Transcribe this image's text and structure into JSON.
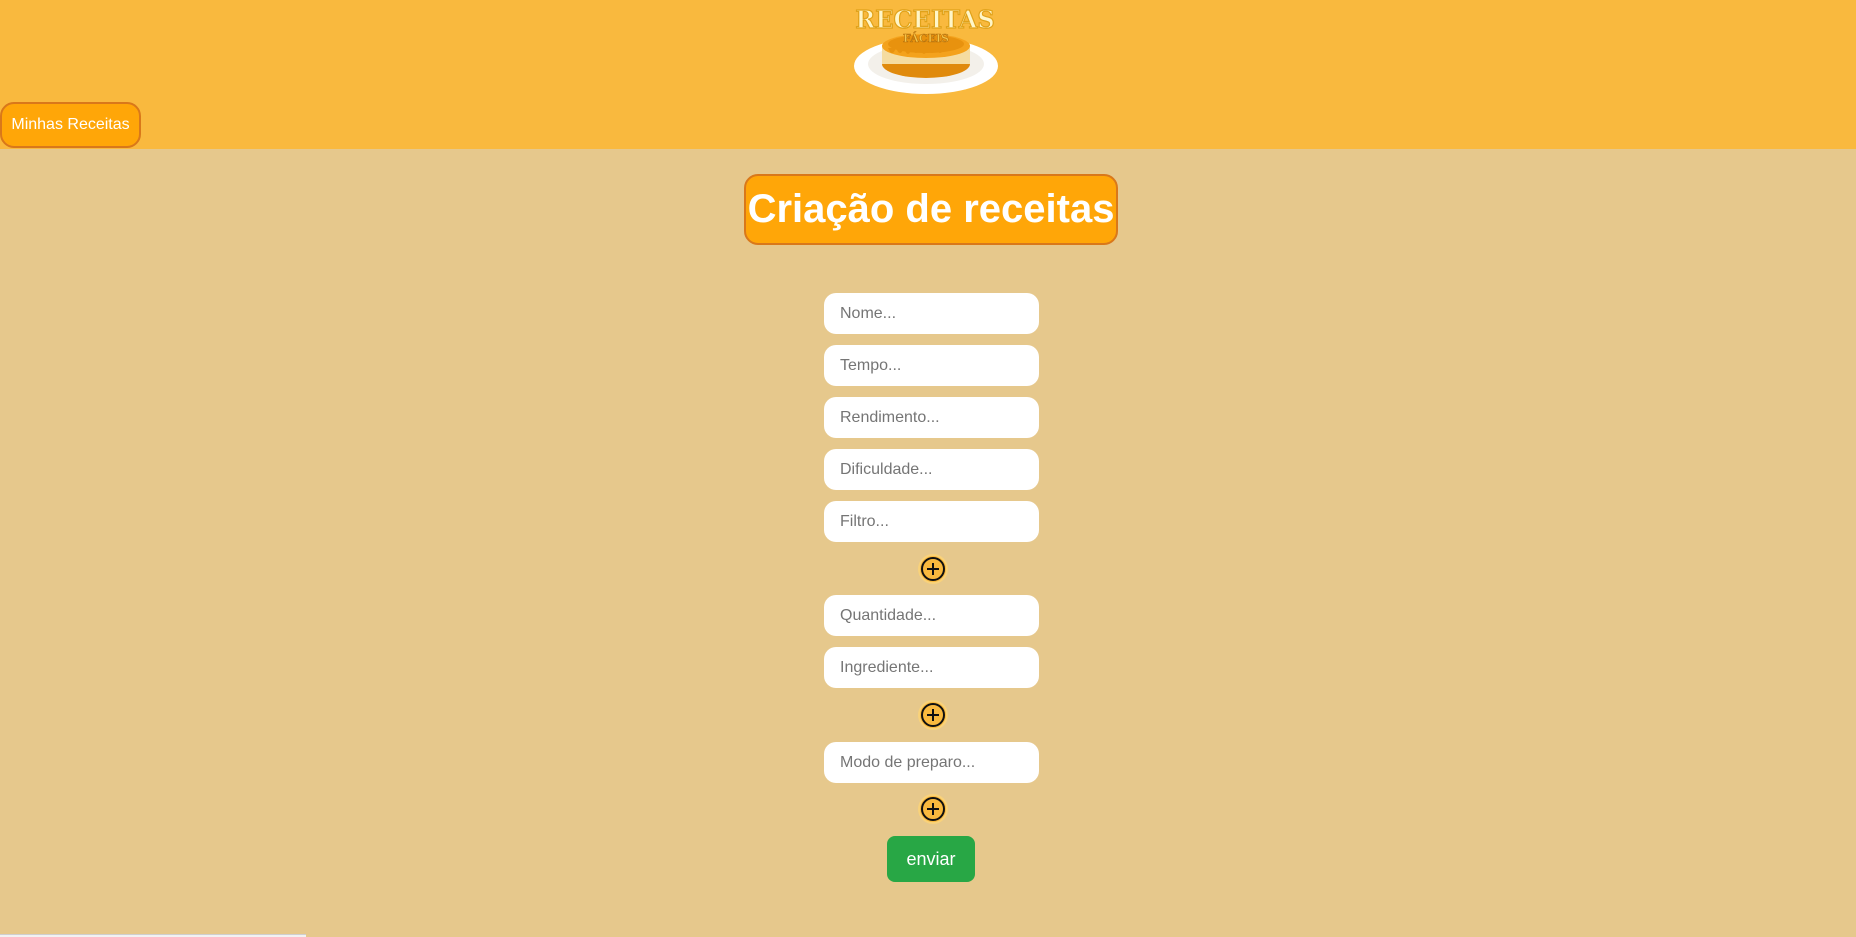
{
  "header": {
    "logo_text_top": "RECEITAS",
    "logo_text_bottom": "FÁCEIS",
    "nav_button_label": "Minhas Receitas"
  },
  "main": {
    "title": "Criação de receitas",
    "fields": {
      "nome": "Nome...",
      "tempo": "Tempo...",
      "rendimento": "Rendimento...",
      "dificuldade": "Dificuldade...",
      "filtro": "Filtro...",
      "quantidade": "Quantidade...",
      "ingrediente": "Ingrediente...",
      "modo_preparo": "Modo de preparo..."
    },
    "add_icon": "plus-circle-icon",
    "submit_label": "enviar"
  },
  "colors": {
    "header_bg": "#f9b93e",
    "page_bg": "#e6c88c",
    "accent": "#ffa608",
    "accent_border": "#d9781a",
    "submit_bg": "#28a745"
  }
}
